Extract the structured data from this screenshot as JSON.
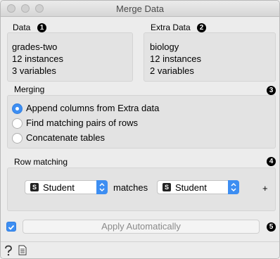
{
  "window": {
    "title": "Merge Data"
  },
  "data_box": {
    "label": "Data",
    "badge": "1",
    "lines": [
      "grades-two",
      "12 instances",
      "3 variables"
    ]
  },
  "extra_box": {
    "label": "Extra Data",
    "badge": "2",
    "lines": [
      "biology",
      "12 instances",
      "2 variables"
    ]
  },
  "merging": {
    "label": "Merging",
    "badge": "3",
    "options": [
      {
        "label": "Append columns from Extra data",
        "selected": true
      },
      {
        "label": "Find matching pairs of rows",
        "selected": false
      },
      {
        "label": "Concatenate tables",
        "selected": false
      }
    ]
  },
  "row_matching": {
    "label": "Row matching",
    "badge": "4",
    "left_combo": {
      "icon_letter": "S",
      "value": "Student"
    },
    "matches_label": "matches",
    "right_combo": {
      "icon_letter": "S",
      "value": "Student"
    },
    "add_label": "+"
  },
  "apply": {
    "checked": true,
    "label": "Apply Automatically",
    "badge": "5"
  },
  "status": {
    "help_icon": "question-icon",
    "report_icon": "document-icon"
  },
  "colors": {
    "accent": "#3d8ef2",
    "panel": "#e3e3e3"
  }
}
